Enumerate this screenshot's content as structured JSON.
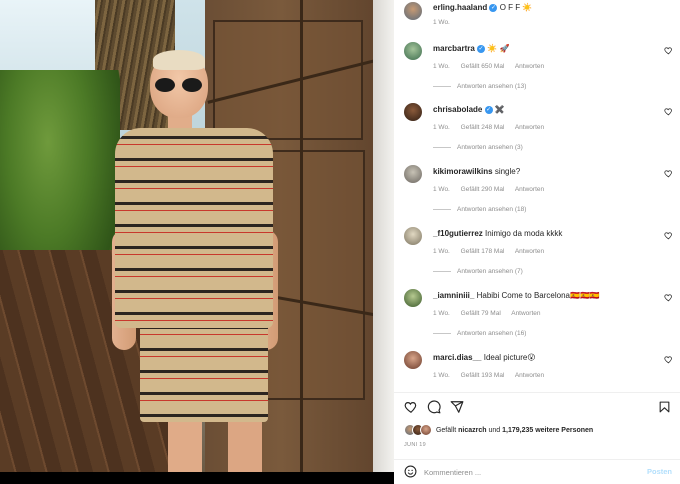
{
  "post": {
    "author": "erling.haaland",
    "caption": "O F F",
    "caption_emoji": "☀️",
    "age": "1 Wo."
  },
  "comments": [
    {
      "user": "marcbartra",
      "verified": true,
      "text": "☀️ 🚀",
      "age": "1 Wo.",
      "likes": "Gefällt 650 Mal",
      "reply": "Antworten",
      "view_replies": "Antworten ansehen (13)"
    },
    {
      "user": "chrisabolade",
      "verified": true,
      "text": "✖️",
      "age": "1 Wo.",
      "likes": "Gefällt 248 Mal",
      "reply": "Antworten",
      "view_replies": "Antworten ansehen (3)"
    },
    {
      "user": "kikimorawilkins",
      "verified": false,
      "text": "single?",
      "age": "1 Wo.",
      "likes": "Gefällt 290 Mal",
      "reply": "Antworten",
      "view_replies": "Antworten ansehen (18)"
    },
    {
      "user": "_f10gutierrez",
      "verified": false,
      "text": "Inimigo da moda kkkk",
      "age": "1 Wo.",
      "likes": "Gefällt 178 Mal",
      "reply": "Antworten",
      "view_replies": "Antworten ansehen (7)"
    },
    {
      "user": "_iamniniii_",
      "verified": false,
      "text": "Habibi Come to Barcelona🇪🇸🇪🇸🇪🇸",
      "age": "1 Wo.",
      "likes": "Gefällt 79 Mal",
      "reply": "Antworten",
      "view_replies": "Antworten ansehen (16)"
    },
    {
      "user": "marci.dias__",
      "verified": false,
      "text": "Ideal picture😮",
      "age": "1 Wo.",
      "likes": "Gefällt 193 Mal",
      "reply": "Antworten",
      "view_replies": ""
    }
  ],
  "actions": {
    "like_icon": "heart-outline-icon",
    "comment_icon": "comment-bubble-icon",
    "share_icon": "paper-plane-icon",
    "save_icon": "bookmark-icon"
  },
  "likes": {
    "prefix": "Gefällt",
    "user": "nicazrch",
    "middle": " und ",
    "count": "1,179,235 weitere Personen"
  },
  "date": "JUNI 19",
  "composer": {
    "placeholder": "Kommentieren ...",
    "post_label": "Posten",
    "emoji_icon": "smiley-icon"
  },
  "colors": {
    "verified": "#3897f0",
    "muted": "#8e8e8e",
    "post_button": "#b2dffc"
  }
}
